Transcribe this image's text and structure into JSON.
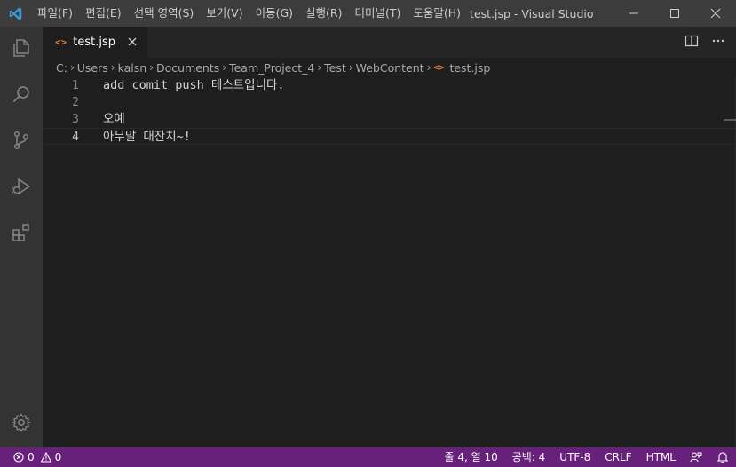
{
  "titlebar": {
    "logo_icon": "vscode-logo-icon",
    "menu": [
      "파일(F)",
      "편집(E)",
      "선택 영역(S)",
      "보기(V)",
      "이동(G)",
      "실행(R)",
      "터미널(T)",
      "도움말(H)"
    ],
    "title": "test.jsp - Visual Studio Code",
    "controls": [
      "minimize-icon",
      "maximize-icon",
      "close-icon"
    ]
  },
  "activity_bar": {
    "items": [
      "explorer-icon",
      "search-icon",
      "source-control-icon",
      "run-debug-icon",
      "extensions-icon"
    ],
    "bottom": "settings-gear-icon"
  },
  "tabs": [
    {
      "label": "test.jsp",
      "icon": "html-file-icon",
      "active": true
    }
  ],
  "tab_actions": [
    "split-editor-icon",
    "more-actions-icon"
  ],
  "breadcrumb": [
    "C:",
    "Users",
    "kalsn",
    "Documents",
    "Team_Project_4",
    "Test",
    "WebContent",
    "test.jsp"
  ],
  "editor": {
    "lines": [
      {
        "number": "1",
        "text": "add comit push 테스트입니다."
      },
      {
        "number": "2",
        "text": ""
      },
      {
        "number": "3",
        "text": "오예"
      },
      {
        "number": "4",
        "text": "아무말 대잔치~!"
      }
    ],
    "current_line": 4
  },
  "status_bar": {
    "errors": "0",
    "warnings": "0",
    "position": "줄 4, 열 10",
    "spaces": "공백: 4",
    "encoding": "UTF-8",
    "eol": "CRLF",
    "language": "HTML",
    "color": "#68217a"
  },
  "colors": {
    "titlebar": "#3c3c3c",
    "activity_bar": "#333333",
    "editor": "#1e1e1e",
    "accent_file_icon": "#e37933",
    "vscode_blue": "#3c99d4"
  }
}
